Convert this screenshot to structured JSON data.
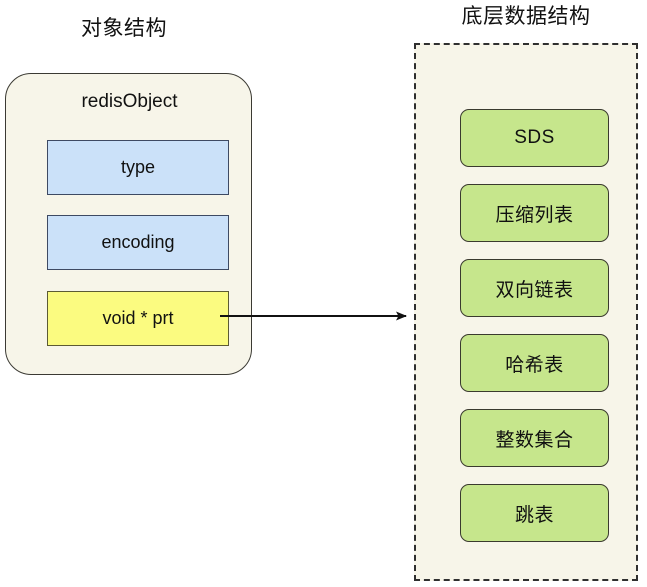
{
  "diagram": {
    "left_panel": {
      "title": "对象结构",
      "card": {
        "title": "redisObject",
        "fields": [
          {
            "label": "type",
            "color": "#CBE1F9"
          },
          {
            "label": "encoding",
            "color": "#CBE1F9"
          },
          {
            "label": "void * prt",
            "color": "#FBFB80"
          }
        ]
      }
    },
    "connector": {
      "name": "pointer-arrow",
      "from": "void * prt",
      "to": "底层数据结构",
      "direction": "right",
      "color": "#111111"
    },
    "right_panel": {
      "title": "底层数据结构",
      "border_style": "dashed",
      "items": [
        {
          "label": "SDS"
        },
        {
          "label": "压缩列表"
        },
        {
          "label": "双向链表"
        },
        {
          "label": "哈希表"
        },
        {
          "label": "整数集合"
        },
        {
          "label": "跳表"
        }
      ]
    },
    "colors": {
      "background": "#FFFFFF",
      "panel_fill": "#F7F5E9",
      "field_blue": "#CBE1F9",
      "field_yellow": "#FBFB80",
      "struct_green": "#C6E68C",
      "stroke": "#3B3A33"
    }
  }
}
